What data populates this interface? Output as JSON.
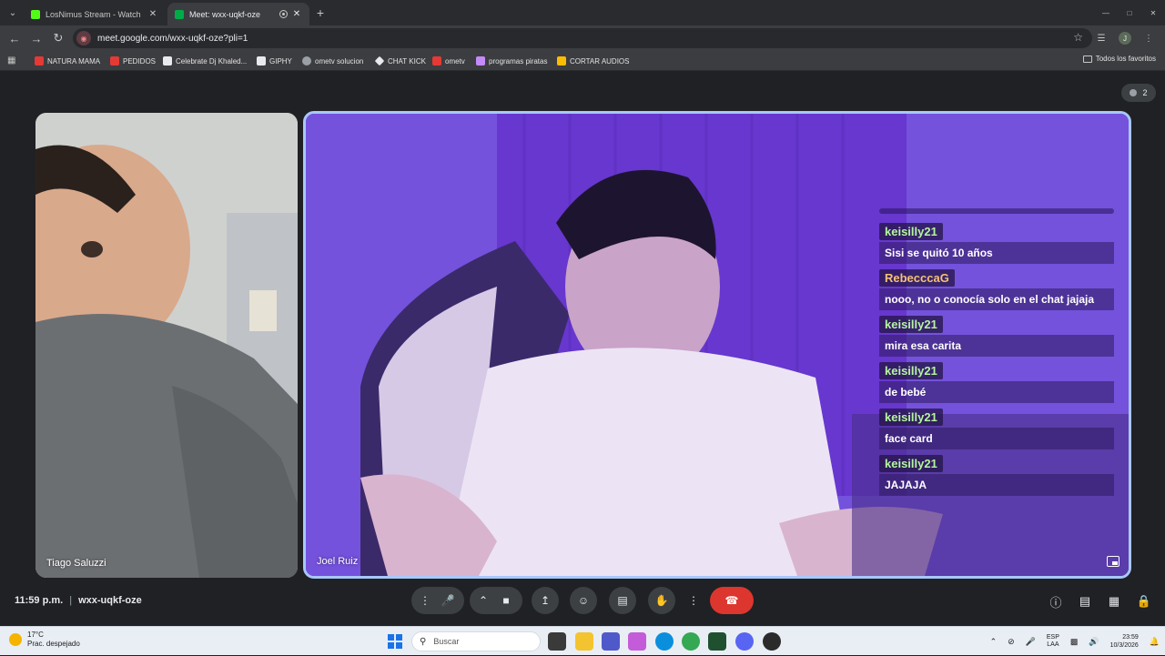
{
  "browser": {
    "tabs": [
      {
        "title": "LosNimus Stream - Watch Live",
        "favicon_color": "#53fc18"
      },
      {
        "title": "Meet: wxx-uqkf-oze",
        "favicon_color": "#00ac47"
      }
    ],
    "url": "meet.google.com/wxx-uqkf-oze?pli=1",
    "profile_initial": "J",
    "bookmarks": [
      {
        "label": "NATURA MAMA",
        "color": "#e53935"
      },
      {
        "label": "PEDIDOS",
        "color": "#e53935"
      },
      {
        "label": "Celebrate Dj Khaled...",
        "color": "#e8eaed"
      },
      {
        "label": "GIPHY",
        "color": "#e8eaed"
      },
      {
        "label": "ometv solucion",
        "color": "#9aa0a6"
      },
      {
        "label": "CHAT KICK",
        "color": "#e8eaed"
      },
      {
        "label": "ometv",
        "color": "#e53935"
      },
      {
        "label": "programas piratas",
        "color": "#c58af9"
      },
      {
        "label": "CORTAR AUDIOS",
        "color": "#fbbc04"
      }
    ],
    "all_bookmarks_label": "Todos los favoritos"
  },
  "meet": {
    "participant_count": "2",
    "tiles": [
      {
        "name": "Tiago Saluzzi"
      },
      {
        "name": "Joel Ruiz"
      }
    ],
    "overlay_chat": [
      {
        "user": "keisilly21",
        "user_color": "#b5f5a0",
        "text": "Sisi se quitó 10 años"
      },
      {
        "user": "RebecccaG",
        "user_color": "#f6c177",
        "text": "nooo, no o conocía solo en el chat jajaja"
      },
      {
        "user": "keisilly21",
        "user_color": "#b5f5a0",
        "text": "mira esa carita"
      },
      {
        "user": "keisilly21",
        "user_color": "#b5f5a0",
        "text": "de bebé"
      },
      {
        "user": "keisilly21",
        "user_color": "#b5f5a0",
        "text": "face card"
      },
      {
        "user": "keisilly21",
        "user_color": "#b5f5a0",
        "text": "JAJAJA"
      }
    ],
    "time": "11:59 p.m.",
    "meeting_code": "wxx-uqkf-oze",
    "end_call_color": "#dc362e"
  },
  "taskbar": {
    "temperature": "17°C",
    "weather": "Prac. despejado",
    "search_placeholder": "Buscar",
    "language_top": "ESP",
    "language_bottom": "LAA",
    "clock_time": "23:59",
    "clock_date": "10/3/2026"
  }
}
